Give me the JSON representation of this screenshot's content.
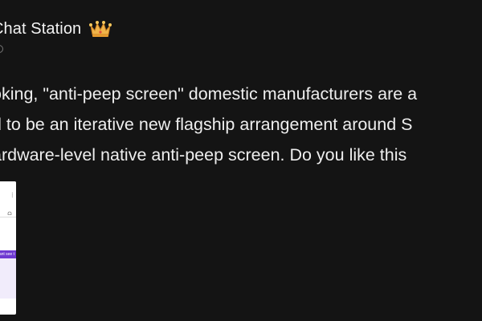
{
  "post": {
    "author": {
      "name": "Chat Station",
      "badge_icon": "crown-icon",
      "badge_color": "#f0b44a"
    },
    "body_lines": [
      "oking, \"anti-peep screen\" domestic manufacturers are a",
      "d to be an iterative new flagship arrangement around S",
      "ardware-level native anti-peep screen. Do you like this"
    ],
    "thumbnail": {
      "banner_text": "ant see t",
      "accent_color": "#6f3ad1"
    }
  }
}
